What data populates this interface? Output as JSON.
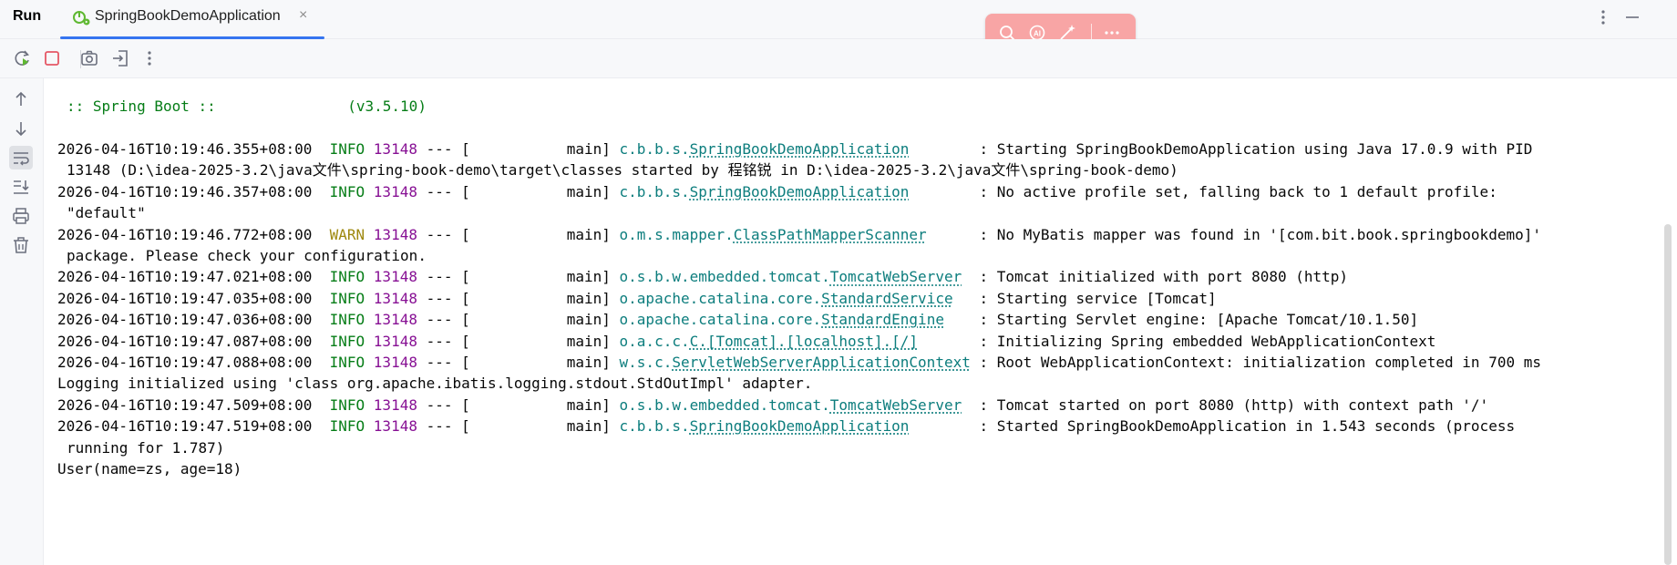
{
  "app": {
    "run_title": "Run"
  },
  "tab": {
    "label": "SpringBookDemoApplication",
    "close": "×"
  },
  "header_icons": {
    "more": "more-vertical-icon",
    "minimize": "minimize-icon"
  },
  "floating_toolbar": {
    "icons": [
      "search-icon",
      "ai-assistant-icon",
      "magic-wand-icon",
      "more-horizontal-icon"
    ]
  },
  "actionbar": {
    "icons": [
      "rerun-icon",
      "stop-icon",
      "camera-icon",
      "exit-icon",
      "more-vertical-icon"
    ]
  },
  "leftbar": {
    "icons": [
      "arrow-up-icon",
      "arrow-down-icon",
      "soft-wrap-icon",
      "scroll-to-end-icon",
      "print-icon",
      "trash-icon"
    ]
  },
  "console": {
    "banner": ":: Spring Boot ::               (v3.5.10)",
    "logs": [
      {
        "ts": "2026-04-16T10:19:46.355+08:00",
        "level": "INFO",
        "pid": "13148",
        "sep": " --- [",
        "thread": "           main] ",
        "pkg": "c.b.b.s.",
        "cls": "SpringBookDemoApplication",
        "pad": "        ",
        "msg": ": Starting SpringBookDemoApplication using Java 17.0.9 with PID",
        "cont": "13148 (D:\\idea-2025-3.2\\java文件\\spring-book-demo\\target\\classes started by 程铭锐 in D:\\idea-2025-3.2\\java文件\\spring-book-demo)"
      },
      {
        "ts": "2026-04-16T10:19:46.357+08:00",
        "level": "INFO",
        "pid": "13148",
        "sep": " --- [",
        "thread": "           main] ",
        "pkg": "c.b.b.s.",
        "cls": "SpringBookDemoApplication",
        "pad": "        ",
        "msg": ": No active profile set, falling back to 1 default profile:",
        "cont": "\"default\""
      },
      {
        "ts": "2026-04-16T10:19:46.772+08:00",
        "level": "WARN",
        "pid": "13148",
        "sep": " --- [",
        "thread": "           main] ",
        "pkg": "o.m.s.mapper.",
        "cls": "ClassPathMapperScanner",
        "pad": "      ",
        "msg": ": No MyBatis mapper was found in '[com.bit.book.springbookdemo]'",
        "cont": "package. Please check your configuration."
      },
      {
        "ts": "2026-04-16T10:19:47.021+08:00",
        "level": "INFO",
        "pid": "13148",
        "sep": " --- [",
        "thread": "           main] ",
        "pkg": "o.s.b.w.embedded.tomcat.",
        "cls": "TomcatWebServer",
        "pad": "  ",
        "msg": ": Tomcat initialized with port 8080 (http)"
      },
      {
        "ts": "2026-04-16T10:19:47.035+08:00",
        "level": "INFO",
        "pid": "13148",
        "sep": " --- [",
        "thread": "           main] ",
        "pkg": "o.apache.catalina.core.",
        "cls": "StandardService",
        "pad": "   ",
        "msg": ": Starting service [Tomcat]"
      },
      {
        "ts": "2026-04-16T10:19:47.036+08:00",
        "level": "INFO",
        "pid": "13148",
        "sep": " --- [",
        "thread": "           main] ",
        "pkg": "o.apache.catalina.core.",
        "cls": "StandardEngine",
        "pad": "    ",
        "msg": ": Starting Servlet engine: [Apache Tomcat/10.1.50]"
      },
      {
        "ts": "2026-04-16T10:19:47.087+08:00",
        "level": "INFO",
        "pid": "13148",
        "sep": " --- [",
        "thread": "           main] ",
        "pkg": "o.a.c.c.",
        "cls": "C.[Tomcat].[localhost].[/]",
        "pad": "       ",
        "msg": ": Initializing Spring embedded WebApplicationContext"
      },
      {
        "ts": "2026-04-16T10:19:47.088+08:00",
        "level": "INFO",
        "pid": "13148",
        "sep": " --- [",
        "thread": "           main] ",
        "pkg": "w.s.c.",
        "cls": "ServletWebServerApplicationContext",
        "pad": " ",
        "msg": ": Root WebApplicationContext: initialization completed in 700 ms"
      }
    ],
    "plain_line": "Logging initialized using 'class org.apache.ibatis.logging.stdout.StdOutImpl' adapter.",
    "logs2": [
      {
        "ts": "2026-04-16T10:19:47.509+08:00",
        "level": "INFO",
        "pid": "13148",
        "sep": " --- [",
        "thread": "           main] ",
        "pkg": "o.s.b.w.embedded.tomcat.",
        "cls": "TomcatWebServer",
        "pad": "  ",
        "msg": ": Tomcat started on port 8080 (http) with context path '/'"
      },
      {
        "ts": "2026-04-16T10:19:47.519+08:00",
        "level": "INFO",
        "pid": "13148",
        "sep": " --- [",
        "thread": "           main] ",
        "pkg": "c.b.b.s.",
        "cls": "SpringBookDemoApplication",
        "pad": "        ",
        "msg": ": Started SpringBookDemoApplication in 1.543 seconds (process",
        "cont": "running for 1.787)"
      }
    ],
    "output": "User(name=zs, age=18)"
  }
}
